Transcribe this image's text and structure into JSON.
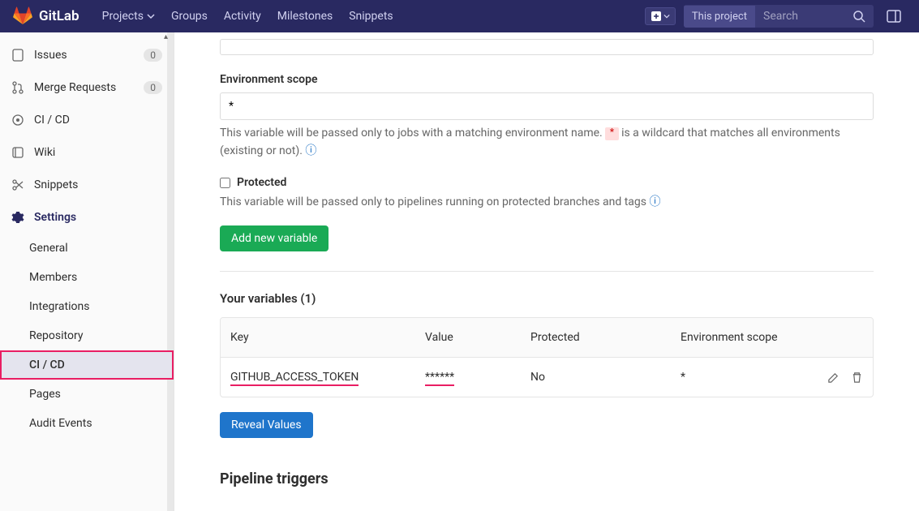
{
  "topbar": {
    "brand": "GitLab",
    "nav": {
      "projects": "Projects",
      "groups": "Groups",
      "activity": "Activity",
      "milestones": "Milestones",
      "snippets": "Snippets"
    },
    "search_scope": "This project",
    "search_placeholder": "Search"
  },
  "sidebar": {
    "issues": {
      "label": "Issues",
      "count": "0"
    },
    "merge_requests": {
      "label": "Merge Requests",
      "count": "0"
    },
    "cicd": "CI / CD",
    "wiki": "Wiki",
    "snippets": "Snippets",
    "settings": "Settings",
    "sub": {
      "general": "General",
      "members": "Members",
      "integrations": "Integrations",
      "repository": "Repository",
      "cicd": "CI / CD",
      "pages": "Pages",
      "audit_events": "Audit Events"
    }
  },
  "main": {
    "env_scope": {
      "label": "Environment scope",
      "value": "*",
      "help_pre": "This variable will be passed only to jobs with a matching environment name. ",
      "wildcard": "*",
      "help_post": " is a wildcard that matches all environments (existing or not). "
    },
    "protected": {
      "label": "Protected",
      "help": "This variable will be passed only to pipelines running on protected branches and tags "
    },
    "add_button": "Add new variable",
    "your_variables": "Your variables (1)",
    "table": {
      "th_key": "Key",
      "th_value": "Value",
      "th_protected": "Protected",
      "th_scope": "Environment scope",
      "row": {
        "key": "GITHUB_ACCESS_TOKEN",
        "value": "******",
        "protected": "No",
        "scope": "*"
      }
    },
    "reveal_button": "Reveal Values",
    "triggers_heading": "Pipeline triggers"
  }
}
